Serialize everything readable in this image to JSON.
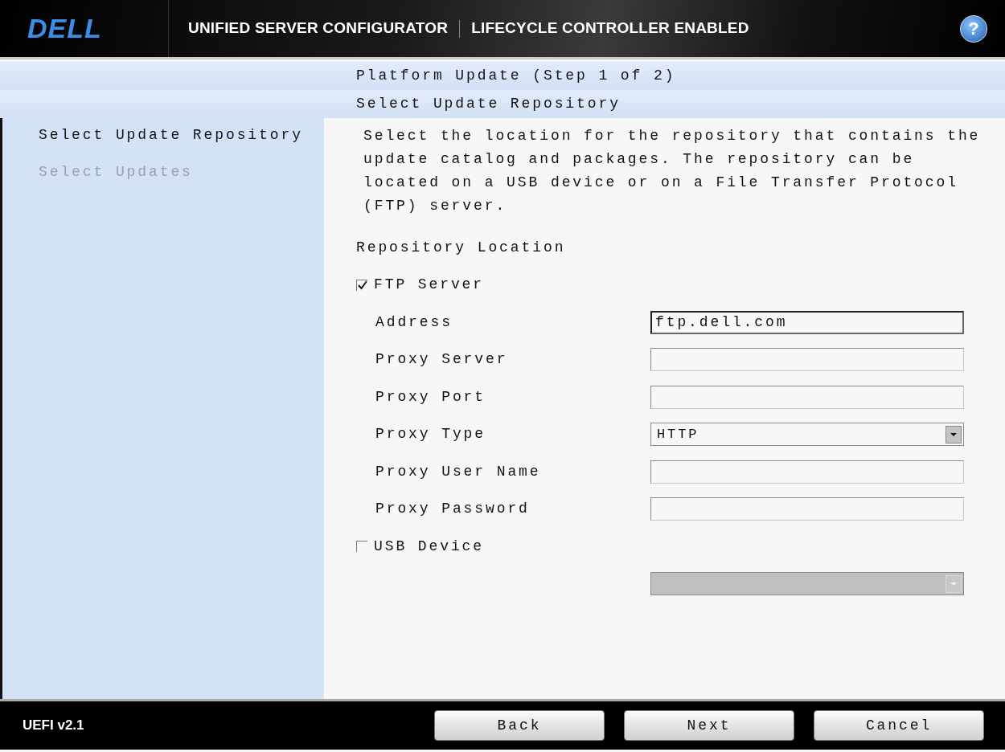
{
  "header": {
    "logo": "DELL",
    "title": "UNIFIED SERVER CONFIGURATOR",
    "subtitle": "LIFECYCLE CONTROLLER ENABLED",
    "help": "?"
  },
  "headings": [
    "Platform Update (Step 1 of 2)",
    "Select Update Repository"
  ],
  "sidebar": {
    "items": [
      {
        "label": "Select Update Repository",
        "selected": true
      },
      {
        "label": "Select Updates",
        "selected": false
      }
    ]
  },
  "description": "Select the location for the repository that contains the update catalog and packages. The repository can be located on a USB device or on a File Transfer Protocol (FTP) server.",
  "repository_location": {
    "label": "Repository Location",
    "options": [
      {
        "label": "FTP Server",
        "checked": true,
        "fields": [
          {
            "kind": "text",
            "label": "Address",
            "value": "ftp.dell.com",
            "focused": true
          },
          {
            "kind": "text",
            "label": "Proxy Server"
          },
          {
            "kind": "text",
            "label": "Proxy Port"
          },
          {
            "kind": "dropdown",
            "label": "Proxy Type",
            "value": "HTTP",
            "disabled": false
          },
          {
            "kind": "text",
            "label": "Proxy User Name"
          },
          {
            "kind": "text",
            "label": "Proxy Password"
          }
        ]
      },
      {
        "label": "USB Device",
        "checked": false,
        "fields": [
          {
            "kind": "dropdown",
            "disabled": true
          }
        ]
      }
    ]
  },
  "footer": {
    "version": "UEFI v2.1",
    "buttons": [
      "Back",
      "Next",
      "Cancel"
    ]
  }
}
